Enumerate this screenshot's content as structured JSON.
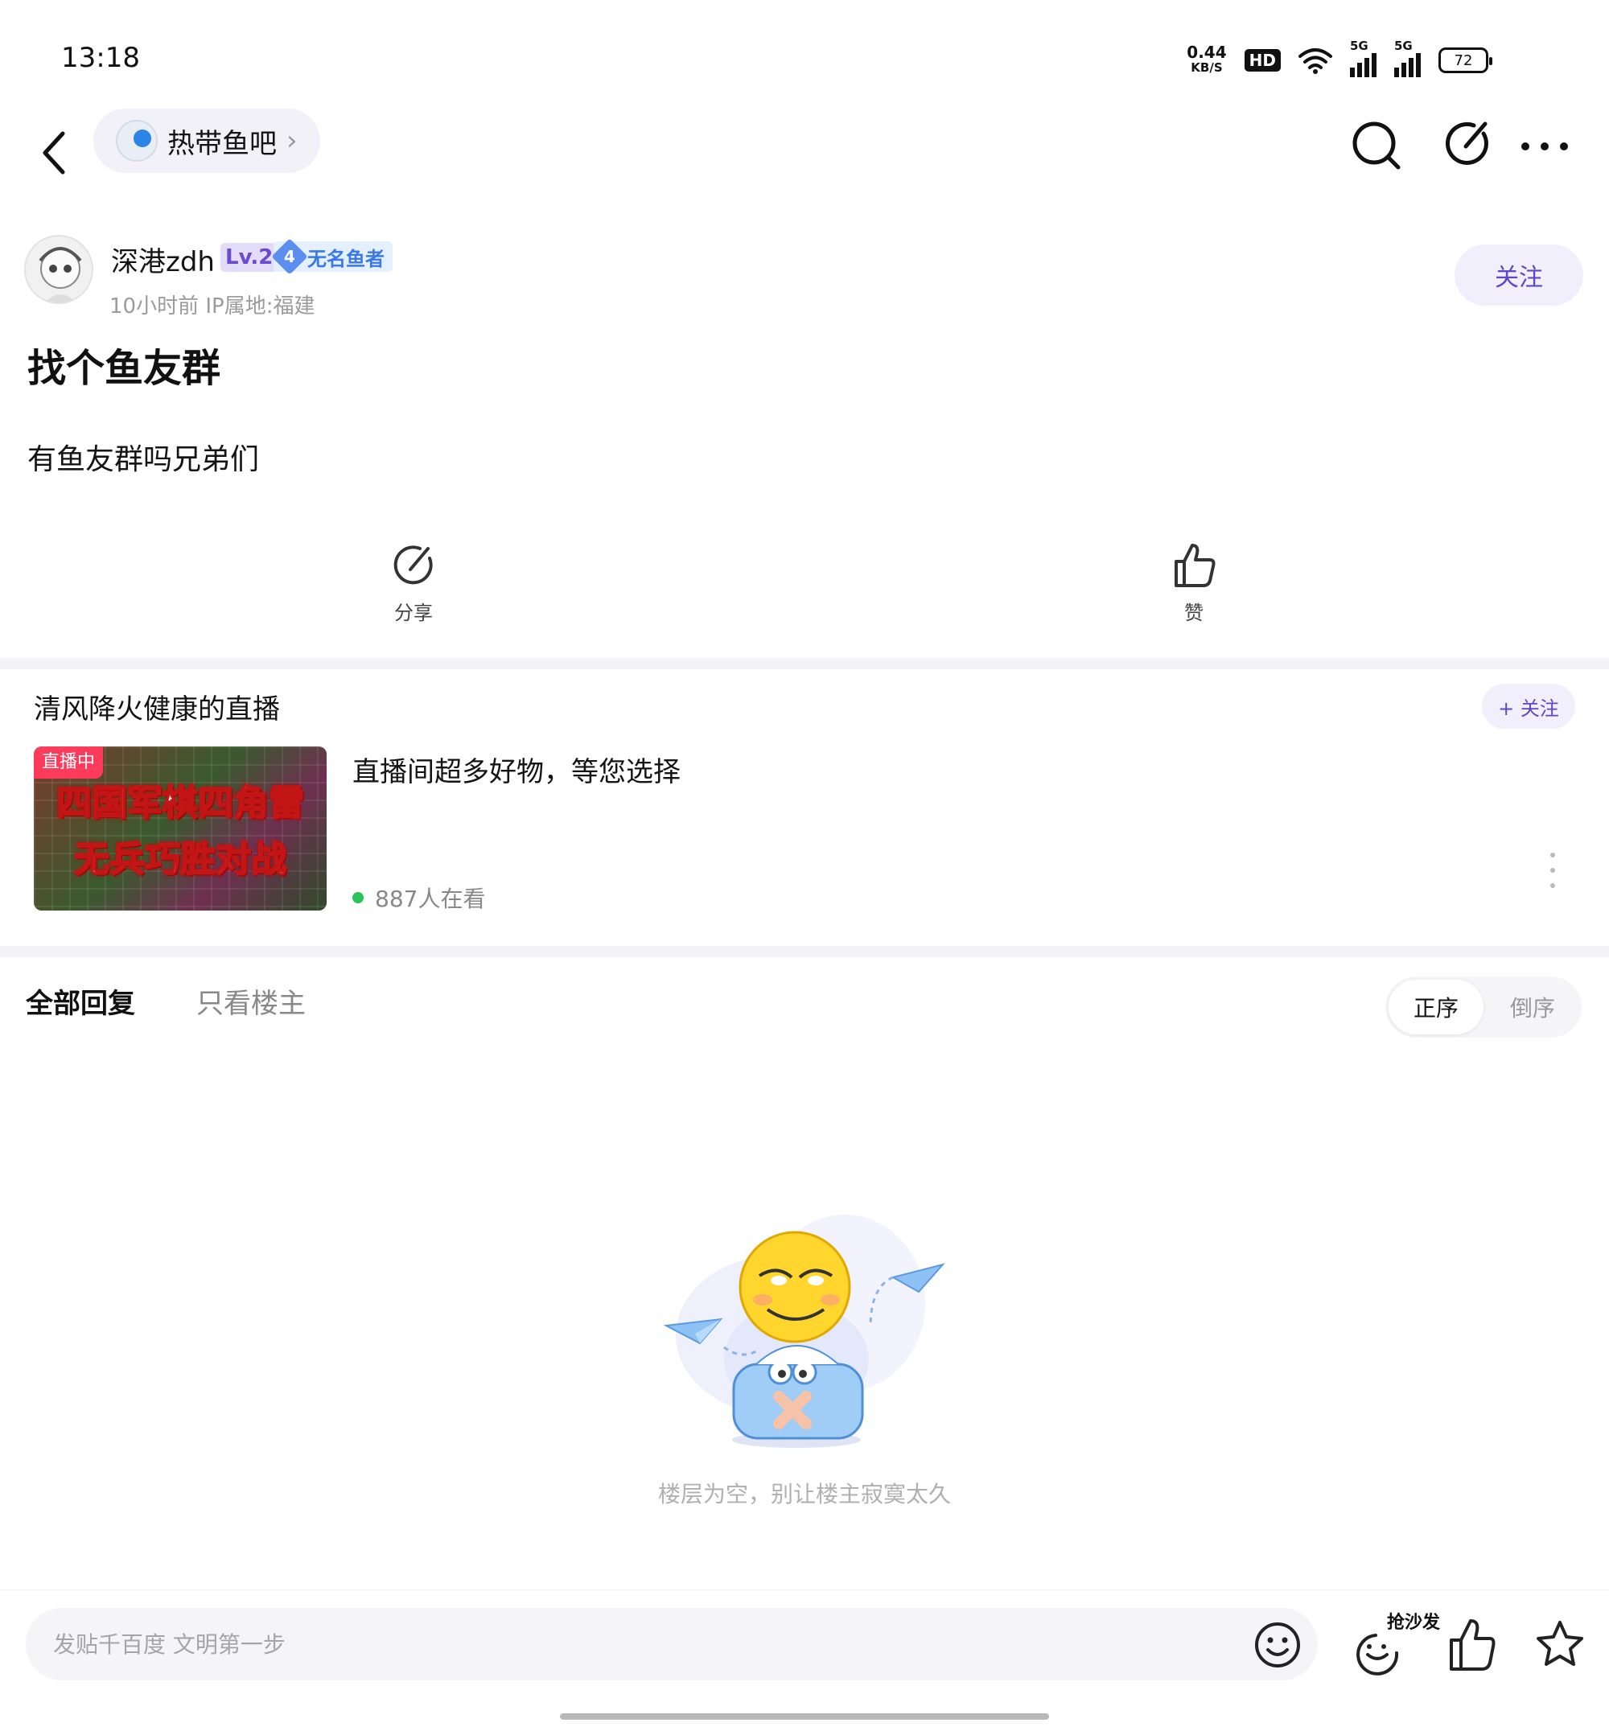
{
  "status_bar": {
    "time": "13:18",
    "net_speed_value": "0.44",
    "net_speed_unit": "KB/S",
    "hd_label": "HD",
    "signal_label_1": "5G",
    "signal_label_2": "5G",
    "battery_level": "72"
  },
  "nav": {
    "forum_name": "热带鱼吧",
    "forum_arrow": "›",
    "icons": [
      "back-icon",
      "search-icon",
      "edit-icon",
      "more-icon"
    ]
  },
  "post": {
    "author_name": "深港zdh",
    "level_badge": "Lv.2",
    "title_badge_number": "4",
    "title_badge_text": "无名鱼者",
    "meta": "10小时前   IP属地:福建",
    "follow_label": "关注",
    "title": "找个鱼友群",
    "body": "有鱼友群吗兄弟们",
    "share_label": "分享",
    "like_label": "赞"
  },
  "live": {
    "section_title": "清风降火健康的直播",
    "follow_label": "+ 关注",
    "tag": "直播中",
    "thumb_line1": "四国军棋四角雷",
    "thumb_line2": "无兵巧胜对战",
    "title": "直播间超多好物，等您选择",
    "viewers": "887人在看"
  },
  "replies": {
    "tab_all": "全部回复",
    "tab_op_only": "只看楼主",
    "sort_asc": "正序",
    "sort_desc": "倒序",
    "empty_text": "楼层为空，别让楼主寂寞太久"
  },
  "bottom_bar": {
    "input_placeholder": "发贴千百度 文明第一步",
    "sofa_label": "抢沙发"
  },
  "colors": {
    "accent": "#5b48c8",
    "chip_bg": "#f2effd",
    "live_tag": "#ff3b5c",
    "live_dot": "#27c45a"
  }
}
